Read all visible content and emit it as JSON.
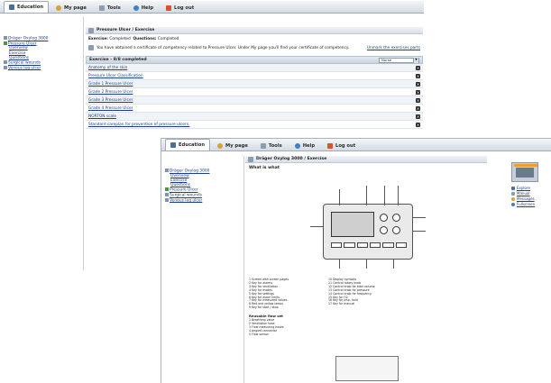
{
  "nav": {
    "tabs": [
      {
        "label": "Education",
        "icon": "education-icon",
        "active": true
      },
      {
        "label": "My page",
        "icon": "my-page-icon",
        "active": false
      },
      {
        "label": "Tools",
        "icon": "tools-icon",
        "active": false
      },
      {
        "label": "Help",
        "icon": "help-icon",
        "active": false
      },
      {
        "label": "Log out",
        "icon": "log-out-icon",
        "active": false
      }
    ]
  },
  "back": {
    "tree": [
      {
        "label": "Dräger Oxylog 3000"
      },
      {
        "label": "Pressure Ulcer"
      },
      {
        "label": "Overview"
      },
      {
        "label": "Exercise"
      },
      {
        "label": "Questions"
      },
      {
        "label": "Surgical wounds"
      },
      {
        "label": "Venous leg ulcer"
      }
    ],
    "panel_title": "Pressure Ulcer / Exercise",
    "status": {
      "exercise_label": "Exercise:",
      "exercise_value": "Completed",
      "questions_label": "Questions:",
      "questions_value": "Completed"
    },
    "certificate_message": "You have obtained a certificate of competency related to Pressure Ulcer. Under My page you'll find your certificate of competency.",
    "unmark_link": "Unmark the exercises parts",
    "exercise_header": "Exercise - 8/8 completed",
    "role_select": "Nurse",
    "exercises": [
      "Anatomy of the skin",
      "Pressure Ulcer Classification",
      "Grade 1 Pressure Ulcer",
      "Grade 2 Pressure Ulcer",
      "Grade 3 Pressure Ulcer",
      "Grade 4 Pressure Ulcer",
      "NORTON scale",
      "Standard careplan for prevention of pressure ulcers."
    ]
  },
  "front": {
    "tree": [
      {
        "label": "Dräger Oxylog 3000"
      },
      {
        "label": "Overview"
      },
      {
        "label": "Exercise"
      },
      {
        "label": "Questions"
      },
      {
        "label": "Pressure Ulcer"
      },
      {
        "label": "Surgical wounds"
      },
      {
        "label": "Venous leg ulcer"
      }
    ],
    "panel_title": "Dräger Oxylog 3000 / Exercise",
    "heading": "What is what",
    "reusable_title": "Reusable flow set",
    "reusable_items": [
      "1  Breathing valve",
      "2  Ventilation hose",
      "3  Flow measuring hoses",
      "4  Angled connector",
      "5  Flow sensor"
    ],
    "side_links": [
      {
        "label": "Explore",
        "icon": "explore-icon"
      },
      {
        "label": "Manual",
        "icon": "manual-icon"
      },
      {
        "label": "Messages",
        "icon": "messages-icon"
      },
      {
        "label": "Fullscreen",
        "icon": "fullscreen-icon"
      }
    ]
  }
}
